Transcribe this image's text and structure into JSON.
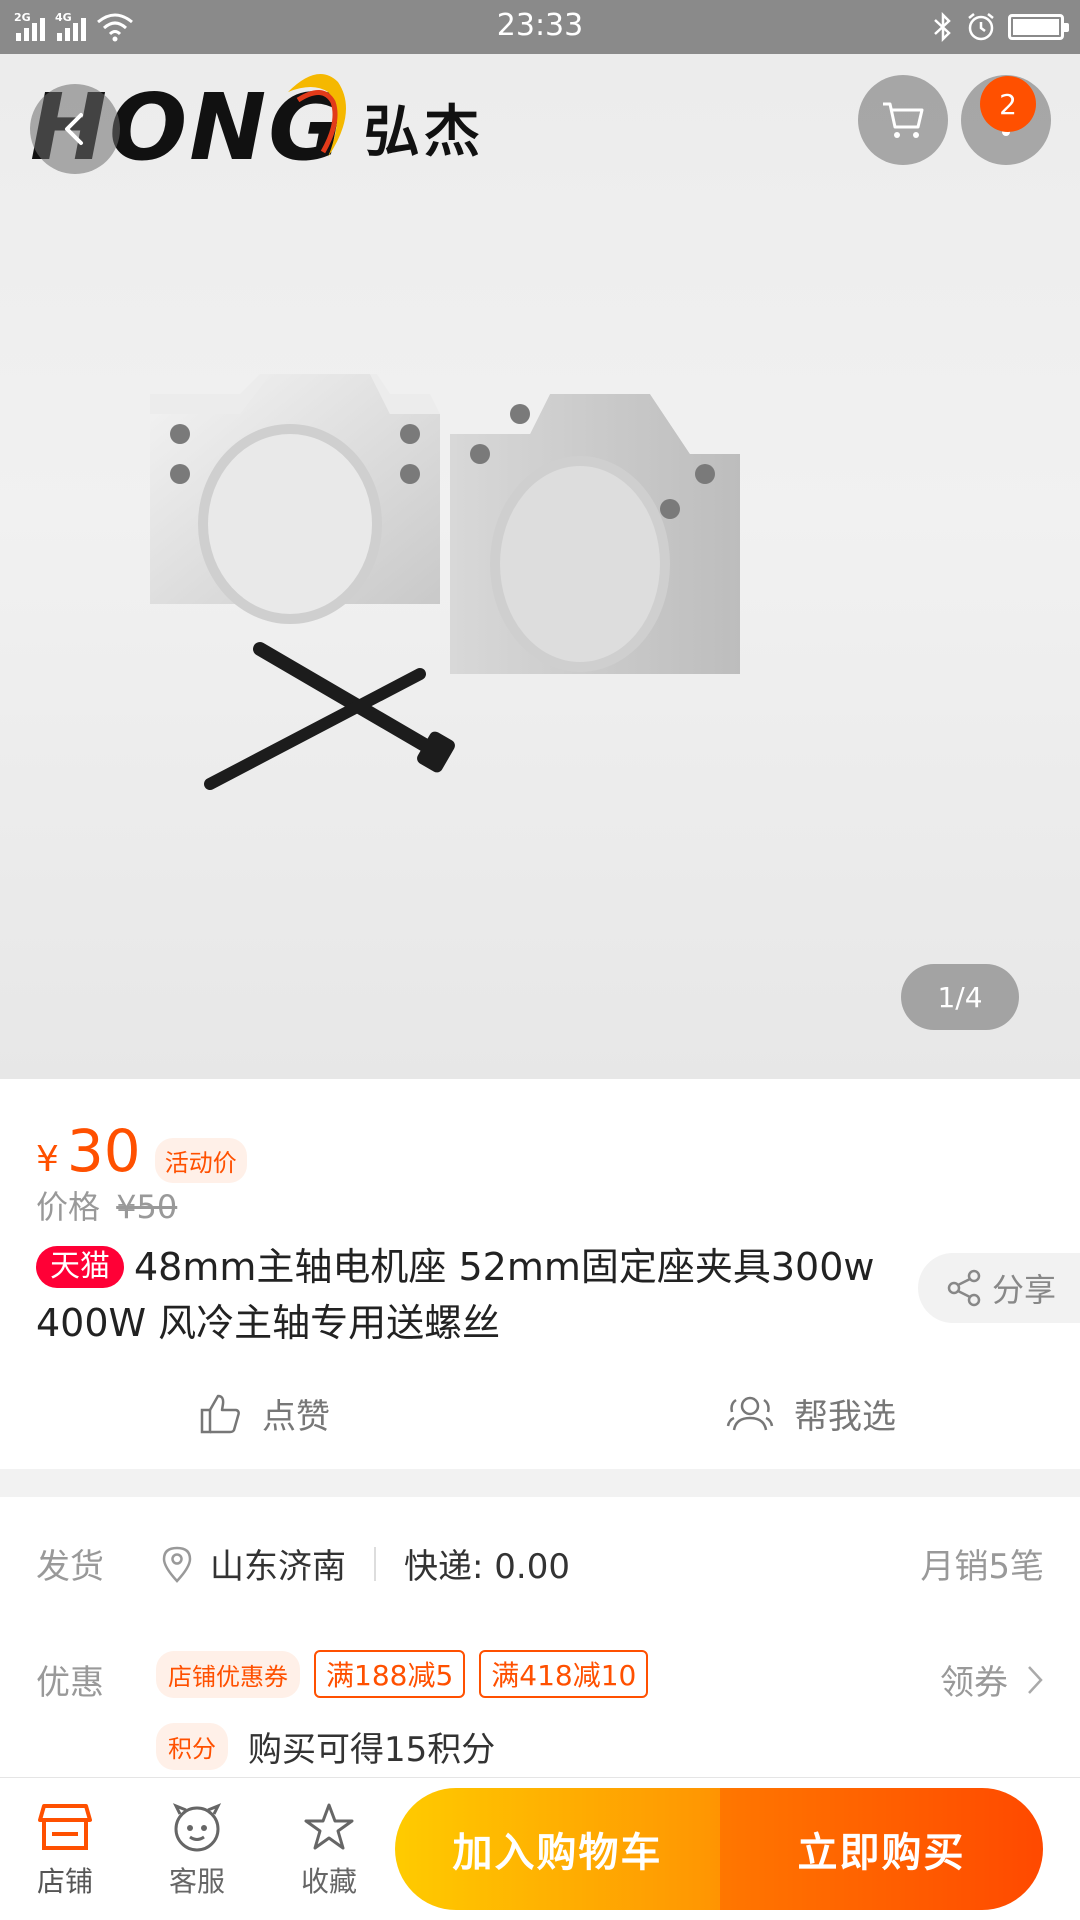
{
  "status_bar": {
    "sim1": "2G",
    "sim2": "4G",
    "time": "23:33"
  },
  "brand": {
    "logo_en": "HONG",
    "logo_cn": "弘杰"
  },
  "header": {
    "cart_badge": "2"
  },
  "gallery": {
    "pager": "1/4"
  },
  "price": {
    "currency": "¥",
    "value": "30",
    "tag": "活动价",
    "original_label": "价格",
    "original_value": "¥50"
  },
  "product": {
    "store_badge": "天猫",
    "title": "48mm主轴电机座 52mm固定座夹具300w 400W 风冷主轴专用送螺丝"
  },
  "share": {
    "label": "分享"
  },
  "actions": {
    "like": "点赞",
    "help_choose": "帮我选"
  },
  "shipping": {
    "label": "发货",
    "location": "山东济南",
    "express": "快递: 0.00",
    "monthly_sales": "月销5笔"
  },
  "promotion": {
    "label": "优惠",
    "store_coupon": "店铺优惠券",
    "coupons": [
      "满188减5",
      "满418减10"
    ],
    "get_coupon": "领券",
    "points_tag": "积分",
    "points_text": "购买可得15积分"
  },
  "bottom_bar": {
    "shop": "店铺",
    "service": "客服",
    "favorite": "收藏",
    "add_to_cart": "加入购物车",
    "buy_now": "立即购买"
  },
  "colors": {
    "accent": "#ff5000",
    "tmall": "#ff0036",
    "cart_gradient": [
      "#ffcb00",
      "#ff9402"
    ],
    "buy_gradient": [
      "#ff7700",
      "#ff4900"
    ]
  }
}
